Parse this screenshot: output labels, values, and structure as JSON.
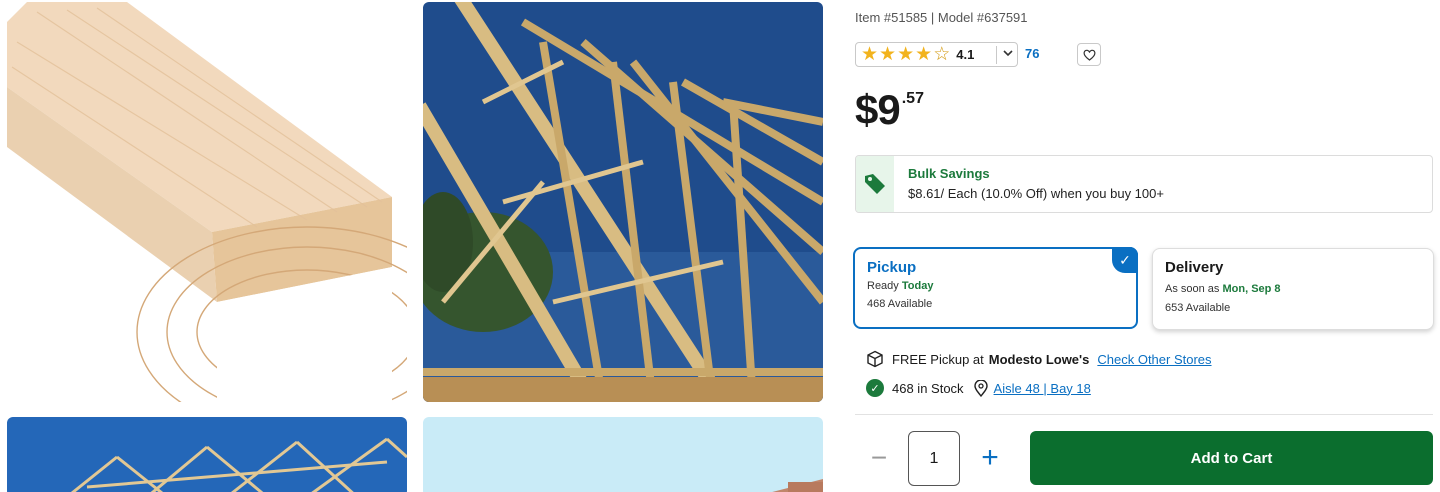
{
  "product": {
    "item_line": "Item #51585 | Model #637591",
    "rating": "4.1",
    "review_count": "76",
    "price_dollars": "$9",
    "price_cents": ".57"
  },
  "icons": {
    "star": "star-icon",
    "favorite": "heart-icon",
    "tag": "tag-icon",
    "box": "box-icon",
    "check": "check-icon",
    "pin": "map-pin-icon"
  },
  "bulk": {
    "title": "Bulk Savings",
    "text": "$8.61/ Each (10.0% Off) when you buy 100+"
  },
  "pickup": {
    "title": "Pickup",
    "ready_prefix": "Ready ",
    "ready_when": "Today",
    "available": "468 Available"
  },
  "delivery": {
    "title": "Delivery",
    "prefix": "As soon as ",
    "date": "Mon, Sep 8",
    "available": "653 Available"
  },
  "store": {
    "free_pickup_prefix": "FREE Pickup at",
    "store_name": "Modesto Lowe's",
    "check_other": "Check Other Stores",
    "in_stock": "468 in Stock",
    "aisle": "Aisle 48 | Bay 18"
  },
  "cart": {
    "quantity": "1",
    "add_label": "Add to Cart"
  },
  "colors": {
    "accent_blue": "#0a6fc2",
    "green": "#0b6e2e",
    "star": "#f2b31d"
  }
}
